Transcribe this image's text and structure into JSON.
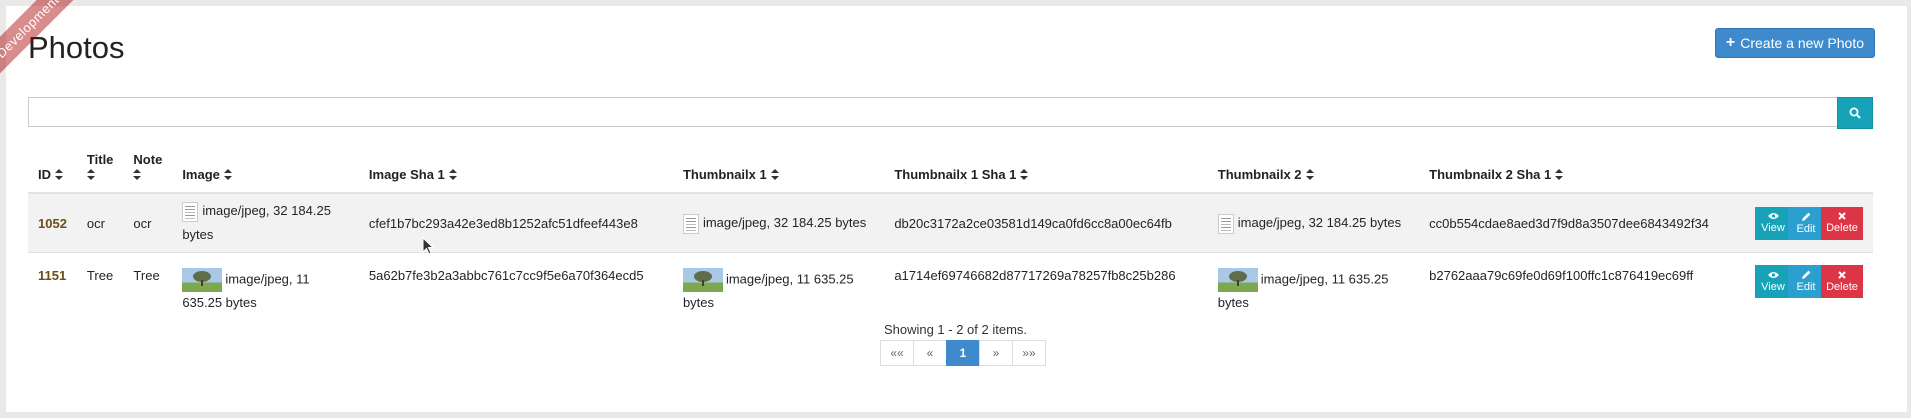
{
  "ribbon": "Development",
  "page": {
    "title": "Photos",
    "create_label": "Create a new Photo"
  },
  "search": {
    "value": "",
    "placeholder": ""
  },
  "columns": [
    "ID",
    "Title",
    "Note",
    "Image",
    "Image Sha 1",
    "Thumbnailx 1",
    "Thumbnailx 1 Sha 1",
    "Thumbnailx 2",
    "Thumbnailx 2 Sha 1"
  ],
  "rows": [
    {
      "id": "1052",
      "title": "ocr",
      "note": "ocr",
      "image": "image/jpeg, 32 184.25 bytes",
      "image_sha": "cfef1b7bc293a42e3ed8b1252afc51dfeef443e8",
      "thumb1": "image/jpeg, 32 184.25 bytes",
      "thumb1_sha": "db20c3172a2ce03581d149ca0fd6cc8a00ec64fb",
      "thumb2": "image/jpeg, 32 184.25 bytes",
      "thumb2_sha": "cc0b554cdae8aed3d7f9d8a3507dee6843492f34"
    },
    {
      "id": "1151",
      "title": "Tree",
      "note": "Tree",
      "image": "image/jpeg, 11 635.25 bytes",
      "image_sha": "5a62b7fe3b2a3abbc761c7cc9f5e6a70f364ecd5",
      "thumb1": "image/jpeg, 11 635.25 bytes",
      "thumb1_sha": "a1714ef69746682d87717269a78257fb8c25b286",
      "thumb2": "image/jpeg, 11 635.25 bytes",
      "thumb2_sha": "b2762aaa79c69fe0d69f100ffc1c876419ec69ff"
    }
  ],
  "actions": {
    "view": "View",
    "edit": "Edit",
    "delete": "Delete"
  },
  "summary": "Showing 1 - 2 of 2 items.",
  "pager": {
    "first": "««",
    "prev": "«",
    "current": "1",
    "next": "»",
    "last": "»»"
  },
  "colors": {
    "primary": "#3e8acc",
    "info": "#17a2b8",
    "danger": "#dc3545",
    "id_link": "#6b4e17"
  },
  "icons": {
    "sort": "sort-icon",
    "search": "search-icon",
    "view": "eye-icon",
    "edit": "pencil-icon",
    "delete": "times-icon",
    "create": "plus-icon"
  }
}
